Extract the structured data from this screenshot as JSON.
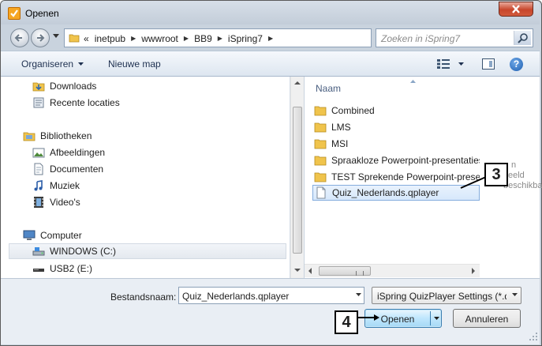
{
  "window": {
    "title": "Openen"
  },
  "address": {
    "overflow": "«",
    "crumbs": [
      "inetpub",
      "wwwroot",
      "BB9",
      "iSpring7"
    ]
  },
  "search": {
    "placeholder": "Zoeken in iSpring7"
  },
  "toolbar": {
    "organize": "Organiseren",
    "new_folder": "Nieuwe map"
  },
  "navpane": {
    "favorites": [
      {
        "label": "Downloads",
        "icon": "downloads-folder-icon"
      },
      {
        "label": "Recente locaties",
        "icon": "recent-places-icon"
      }
    ],
    "libraries_label": "Bibliotheken",
    "libraries": [
      {
        "label": "Afbeeldingen",
        "icon": "pictures-library-icon"
      },
      {
        "label": "Documenten",
        "icon": "documents-library-icon"
      },
      {
        "label": "Muziek",
        "icon": "music-library-icon"
      },
      {
        "label": "Video's",
        "icon": "videos-library-icon"
      }
    ],
    "computer_label": "Computer",
    "drives": [
      {
        "label": "WINDOWS (C:)",
        "icon": "hard-drive-icon",
        "selected": true
      },
      {
        "label": "USB2 (E:)",
        "icon": "usb-drive-icon",
        "selected": false
      }
    ]
  },
  "filelist": {
    "column": "Naam",
    "items": [
      {
        "label": "Combined",
        "type": "folder"
      },
      {
        "label": "LMS",
        "type": "folder"
      },
      {
        "label": "MSI",
        "type": "folder"
      },
      {
        "label": "Spraakloze Powerpoint-presentaties",
        "type": "folder"
      },
      {
        "label": "TEST Sprekende Powerpoint-presentaties",
        "type": "folder"
      },
      {
        "label": "Quiz_Nederlands.qplayer",
        "type": "file",
        "selected": true
      }
    ]
  },
  "preview": {
    "text": "n\neeld\nbeschikbaar"
  },
  "bottom": {
    "filename_label": "Bestandsnaam:",
    "filename_value": "Quiz_Nederlands.qplayer",
    "filter": "iSpring QuizPlayer Settings (*.q",
    "open": "Openen",
    "cancel": "Annuleren"
  },
  "callouts": {
    "three": "3",
    "four": "4"
  },
  "colors": {
    "selection": "#d7e8fb",
    "folder": "#f0c44c",
    "accent": "#3c7fb1"
  }
}
